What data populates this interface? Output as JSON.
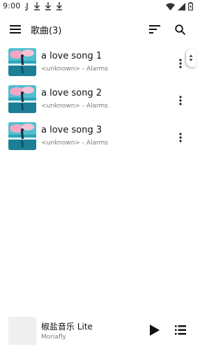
{
  "status_bar": {
    "time": "9:00",
    "left_icons": [
      "notification-icon",
      "download-icon",
      "download-icon",
      "download-icon"
    ],
    "right_icons": [
      "wifi-icon",
      "signal-icon",
      "battery-icon"
    ]
  },
  "toolbar": {
    "title": "歌曲(3)",
    "menu_icon": "menu-icon",
    "sort_icon": "sort-icon",
    "search_icon": "search-icon"
  },
  "songs": [
    {
      "title": "a love song 1",
      "subtitle": "<unknown> - Alarms"
    },
    {
      "title": "a love song 2",
      "subtitle": "<unknown> - Alarms"
    },
    {
      "title": "a love song 3",
      "subtitle": "<unknown> - Alarms"
    }
  ],
  "mini_player": {
    "title": "椒盐音乐 Lite",
    "artist": "Moriafly",
    "play_icon": "play-icon",
    "queue_icon": "queue-icon"
  },
  "colors": {
    "primary_text": "#111111",
    "secondary_text": "#7a7a7a",
    "background": "#ffffff",
    "cover_placeholder": "#efefef"
  }
}
